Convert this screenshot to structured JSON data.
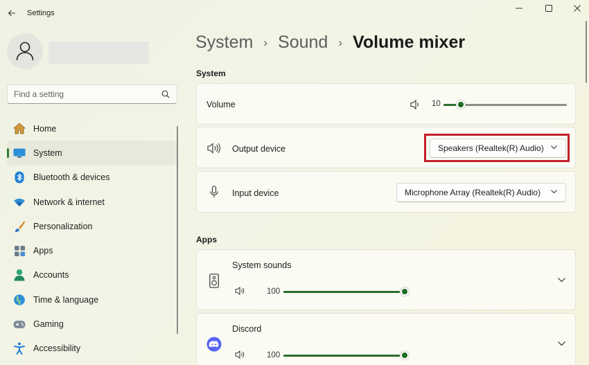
{
  "window": {
    "title": "Settings"
  },
  "sidebar": {
    "search_placeholder": "Find a setting",
    "items": [
      {
        "label": "Home",
        "icon": "home-icon",
        "active": false
      },
      {
        "label": "System",
        "icon": "monitor-icon",
        "active": true
      },
      {
        "label": "Bluetooth & devices",
        "icon": "bluetooth-icon",
        "active": false
      },
      {
        "label": "Network & internet",
        "icon": "wifi-icon",
        "active": false
      },
      {
        "label": "Personalization",
        "icon": "brush-icon",
        "active": false
      },
      {
        "label": "Apps",
        "icon": "apps-icon",
        "active": false
      },
      {
        "label": "Accounts",
        "icon": "person-icon",
        "active": false
      },
      {
        "label": "Time & language",
        "icon": "globe-icon",
        "active": false
      },
      {
        "label": "Gaming",
        "icon": "gamepad-icon",
        "active": false
      },
      {
        "label": "Accessibility",
        "icon": "accessibility-icon",
        "active": false
      }
    ]
  },
  "breadcrumb": [
    "System",
    "Sound",
    "Volume mixer"
  ],
  "system_section": {
    "title": "System",
    "volume": {
      "label": "Volume",
      "value": "10",
      "level": 0.1
    },
    "output": {
      "label": "Output device",
      "selected": "Speakers (Realtek(R) Audio)"
    },
    "input": {
      "label": "Input device",
      "selected": "Microphone Array (Realtek(R) Audio)"
    }
  },
  "apps_section": {
    "title": "Apps",
    "apps": [
      {
        "name": "System sounds",
        "volume": "100",
        "level": 1.0,
        "icon": "speaker-device-icon"
      },
      {
        "name": "Discord",
        "volume": "100",
        "level": 1.0,
        "icon": "discord-icon"
      }
    ]
  },
  "colors": {
    "accent": "#1e6e24",
    "highlight": "#c21f2a",
    "discord": "#5865f2"
  }
}
